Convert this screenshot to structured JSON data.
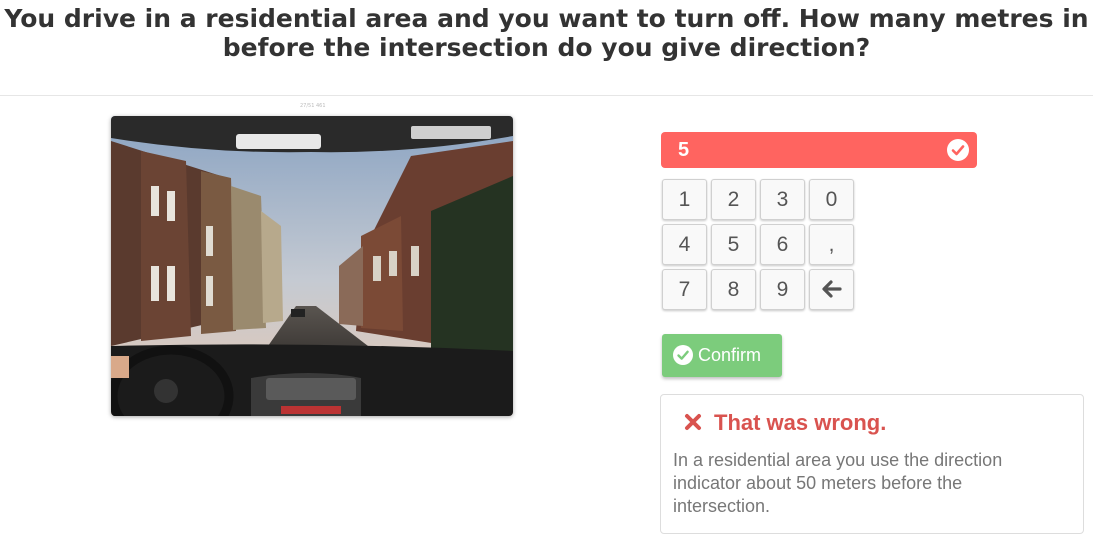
{
  "question": "You drive in a residential area and you want to turn off. How many metres in before the intersection do you give direction?",
  "image_caption": "27/51 461",
  "answer": {
    "value": "5",
    "status_icon": "check-circle-icon",
    "color": "#ff6460"
  },
  "keypad": {
    "keys": [
      "1",
      "2",
      "3",
      "0",
      "4",
      "5",
      "6",
      ",",
      "7",
      "8",
      "9"
    ],
    "backspace_icon": "arrow-left-icon"
  },
  "confirm": {
    "label": "Confirm",
    "icon": "check-circle-icon",
    "color": "#7ccc7c"
  },
  "feedback": {
    "icon": "x-mark-icon",
    "title": "That was wrong.",
    "body": "In a residential area you use the direction indicator about 50 meters before the intersection.",
    "color": "#d9534f"
  }
}
